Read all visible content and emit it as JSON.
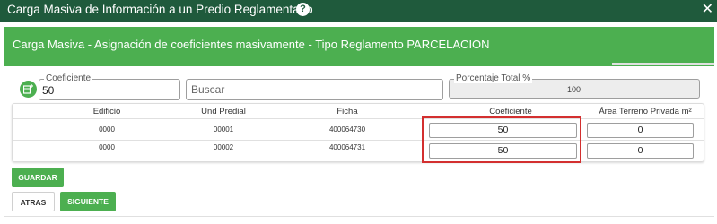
{
  "window": {
    "title": "Carga Masiva de Información a un Predio Reglamentado",
    "help_icon": "question-circle-icon",
    "close_icon": "close-icon",
    "help_glyph": "?",
    "close_glyph": "✕"
  },
  "panel": {
    "title": "Carga Masiva - Asignación de coeficientes masivamente - Tipo Reglamento PARCELACION",
    "color": "#4caf50"
  },
  "form": {
    "add_icon": "add-table-icon",
    "coeficiente_label": "Coeficiente",
    "coeficiente_value": "50",
    "search_placeholder": "Buscar",
    "total_label": "Porcentaje Total %",
    "total_value": "100"
  },
  "table": {
    "headers": [
      "Edificio",
      "Und Predial",
      "Ficha",
      "Coeficiente",
      "Área Terreno Privada m²"
    ],
    "rows": [
      {
        "edificio": "0000",
        "und_predial": "00001",
        "ficha": "400064730",
        "coeficiente": "50",
        "area": "0"
      },
      {
        "edificio": "0000",
        "und_predial": "00002",
        "ficha": "400064731",
        "coeficiente": "50",
        "area": "0"
      }
    ]
  },
  "buttons": {
    "guardar": "GUARDAR",
    "atras": "ATRAS",
    "siguiente": "SIGUIENTE"
  },
  "colors": {
    "titlebar": "#1f5a3c",
    "accent": "#4caf50",
    "highlight": "#d32f2f"
  }
}
